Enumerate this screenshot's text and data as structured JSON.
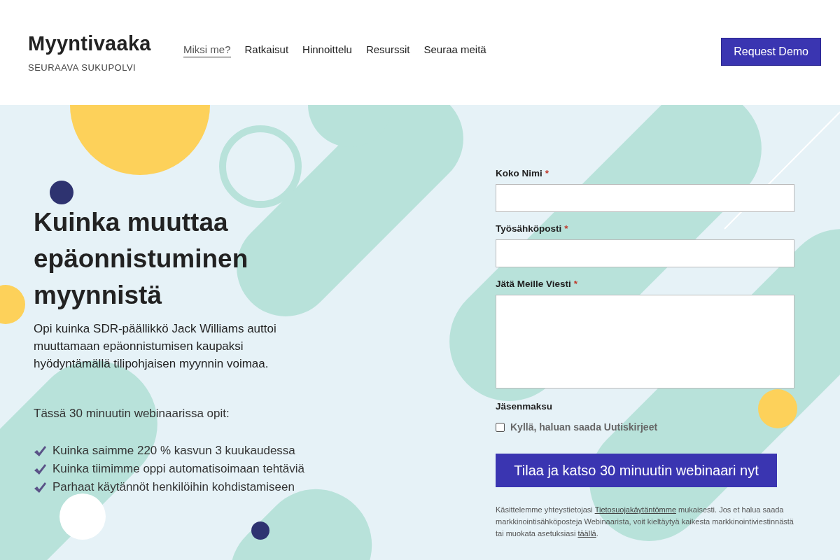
{
  "header": {
    "brand": "Myyntivaaka",
    "tagline": "SEURAAVA SUKUPOLVI",
    "nav": [
      {
        "label": "Miksi me?",
        "selected": true
      },
      {
        "label": "Ratkaisut",
        "selected": false
      },
      {
        "label": "Hinnoittelu",
        "selected": false
      },
      {
        "label": "Resurssit",
        "selected": false
      },
      {
        "label": "Seuraa meitä",
        "selected": false
      }
    ],
    "cta": "Request Demo"
  },
  "hero": {
    "heading": "Kuinka muuttaa epäonnistuminen myynnistä",
    "lead": "Opi kuinka SDR-päällikkö Jack Williams auttoi muuttamaan epäonnistumisen kaupaksi hyödyntämällä tilipohjaisen myynnin voimaa.",
    "intro": "Tässä 30 minuutin webinaarissa opit:",
    "points": [
      "Kuinka saimme 220 % kasvun 3 kuukaudessa",
      "Kuinka tiimimme oppi automatisoimaan tehtäviä",
      "Parhaat käytännöt henkilöihin kohdistamiseen"
    ]
  },
  "form": {
    "fields": [
      {
        "label": "Koko Nimi",
        "required_mark": "*",
        "kind": "input"
      },
      {
        "label": "Työsähköposti",
        "required_mark": "*",
        "kind": "input"
      },
      {
        "label": "Jätä Meille Viesti",
        "required_mark": "*",
        "kind": "textarea"
      }
    ],
    "section": "Jäsenmaksu",
    "checkbox": {
      "label": "Kyllä, haluan saada Uutiskirjeet",
      "checked": false
    },
    "submit": "Tilaa ja katso 30 minuutin webinaari nyt",
    "privacy": {
      "before": "Käsittelemme yhteystietojasi ",
      "link": "Tietosuojakäytäntömme",
      "middle": " mukaisesti. Jos et halua saada markkinointisähköposteja Webinaarista, voit kieltäytyä kaikesta markkinointiviestinnästä tai muokata asetuksiasi ",
      "link2": "täällä",
      "after": "."
    }
  }
}
